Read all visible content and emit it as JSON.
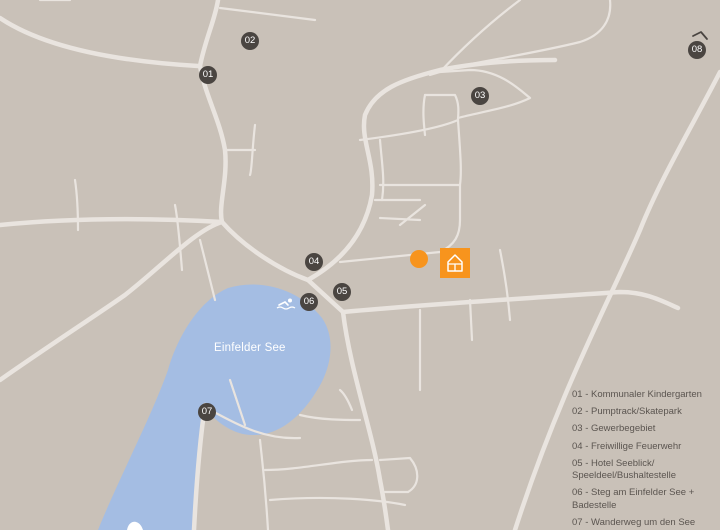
{
  "colors": {
    "land": "#c9c1b8",
    "road": "#e9e4df",
    "water": "#a4bde3",
    "marker": "#4a4541",
    "accent": "#f7941d",
    "legend_text": "#5b5550"
  },
  "lake": {
    "name": "Einfelder See"
  },
  "markers": [
    "01",
    "02",
    "03",
    "04",
    "05",
    "06",
    "07",
    "08"
  ],
  "icons": {
    "home": "home-icon",
    "swim": "swimmer-icon",
    "hook": "hook-icon",
    "boat": "boat-icon"
  },
  "legend": [
    "01 - Kommunaler Kindergarten",
    "02 - Pumptrack/Skatepark",
    "03 - Gewerbegebiet",
    "04 - Freiwillige Feuerwehr",
    "05 - Hotel Seeblick/ Speeldeel/Bushaltestelle",
    "06 - Steg am Einfelder See + Badestelle",
    "07 - Wanderweg um den See"
  ]
}
